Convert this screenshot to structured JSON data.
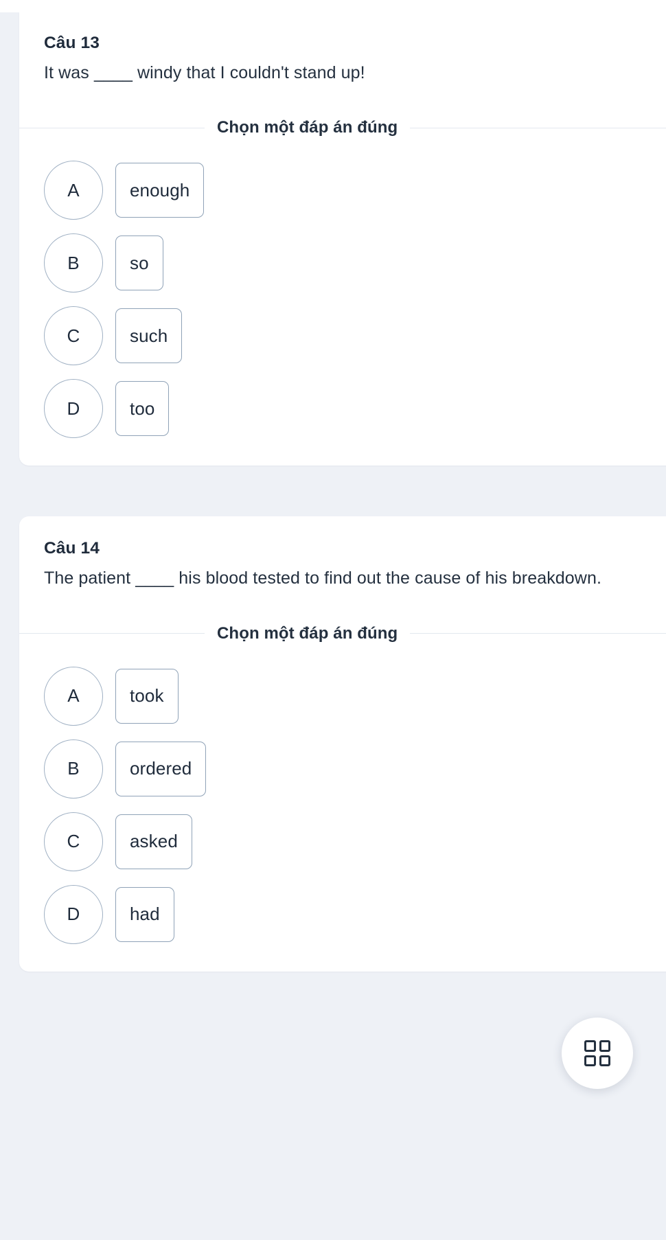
{
  "theme": {
    "page_background": "#eef1f6",
    "card_background": "#ffffff",
    "text_color": "#24303f",
    "option_border": "#8fa2b7",
    "divider_color": "#e3e8ef"
  },
  "questions": [
    {
      "number_label": "Câu 13",
      "prompt": "It was ____ windy that I couldn't stand up!",
      "instruction": "Chọn một đáp án đúng",
      "options": [
        {
          "letter": "A",
          "text": "enough"
        },
        {
          "letter": "B",
          "text": "so"
        },
        {
          "letter": "C",
          "text": "such"
        },
        {
          "letter": "D",
          "text": "too"
        }
      ]
    },
    {
      "number_label": "Câu 14",
      "prompt": "The patient ____ his blood tested to find out the cause of his breakdown.",
      "instruction": "Chọn một đáp án đúng",
      "options": [
        {
          "letter": "A",
          "text": "took"
        },
        {
          "letter": "B",
          "text": "ordered"
        },
        {
          "letter": "C",
          "text": "asked"
        },
        {
          "letter": "D",
          "text": "had"
        }
      ]
    }
  ],
  "floating_button": {
    "icon": "grid-icon",
    "label": ""
  }
}
